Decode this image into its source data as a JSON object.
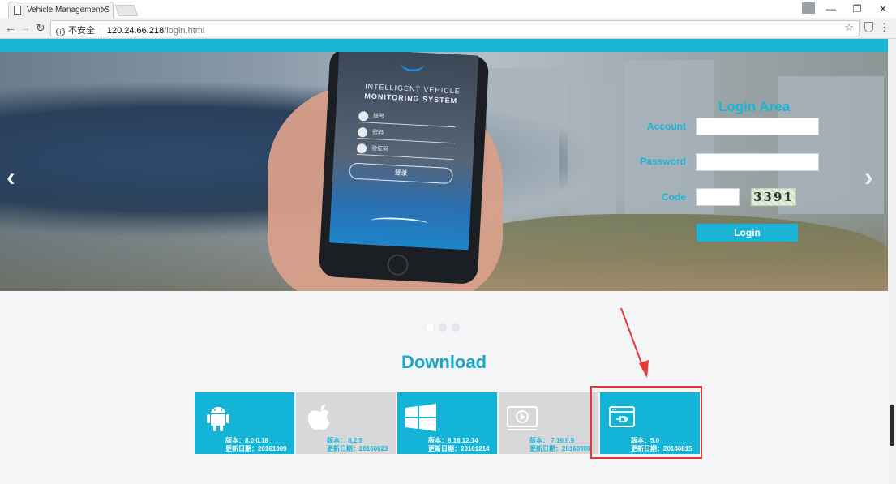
{
  "browser": {
    "tab_title": "Vehicle Management S",
    "security_label": "不安全",
    "url_host": "120.24.66.218",
    "url_path": "/login.html"
  },
  "hero": {
    "phone": {
      "title_line1": "INTELLIGENT   VEHICLE",
      "title_line2": "MONITORING  SYSTEM",
      "field_account": "账号",
      "field_password": "密码",
      "field_code": "验证码",
      "button": "登录"
    }
  },
  "login": {
    "title": "Login Area",
    "account_label": "Account",
    "password_label": "Password",
    "code_label": "Code",
    "captcha_text": "3391",
    "button_label": "Login"
  },
  "download": {
    "title": "Download",
    "tiles": [
      {
        "icon": "android-icon",
        "style": "blue",
        "version": "版本：8.0.0.18",
        "date": "更新日期：20161009"
      },
      {
        "icon": "apple-icon",
        "style": "gray",
        "version": "版本：  8.2.5",
        "date": "更新日期：20160623"
      },
      {
        "icon": "windows-icon",
        "style": "blue",
        "version": "版本：8.16.12.14",
        "date": "更新日期：20161214"
      },
      {
        "icon": "video-player-icon",
        "style": "gray",
        "version": "版本：  7.16.9.9",
        "date": "更新日期：20160909"
      },
      {
        "icon": "browser-plugin-icon",
        "style": "blue",
        "version": "版本：5.0",
        "date": "更新日期：20140815"
      }
    ]
  },
  "colors": {
    "accent": "#19b5d6",
    "highlight": "#e53935"
  }
}
